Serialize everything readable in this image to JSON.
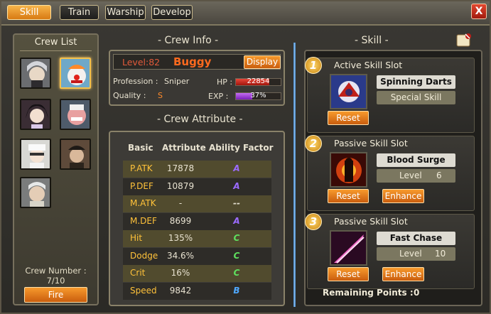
{
  "tabs": [
    {
      "label": "Skill",
      "active": true
    },
    {
      "label": "Train",
      "active": false
    },
    {
      "label": "Warship",
      "active": false
    },
    {
      "label": "Develop",
      "active": false
    }
  ],
  "close_label": "X",
  "crew_list": {
    "title": "Crew List",
    "crew_number_label": "Crew Number :",
    "crew_number": "7/10",
    "fire_label": "Fire"
  },
  "crew_info": {
    "title": "- Crew Info -",
    "level": "Level:82",
    "name": "Buggy",
    "display_label": "Display",
    "profession_label": "Profession :",
    "profession": "Sniper",
    "quality_label": "Quality :",
    "quality": "S",
    "hp_label": "HP :",
    "hp": "22854",
    "exp_label": "EXP :",
    "exp": "37%",
    "exp_fraction": 0.37,
    "hp_fraction": 0.75
  },
  "crew_attribute": {
    "title": "- Crew Attribute -",
    "headers": [
      "Basic",
      "Attribute",
      "Ability Factor"
    ],
    "rows": [
      {
        "basic": "P.ATK",
        "attribute": "17878",
        "factor": "A"
      },
      {
        "basic": "P.DEF",
        "attribute": "10879",
        "factor": "A"
      },
      {
        "basic": "M.ATK",
        "attribute": "-",
        "factor": "--"
      },
      {
        "basic": "M.DEF",
        "attribute": "8699",
        "factor": "A"
      },
      {
        "basic": "Hit",
        "attribute": "135%",
        "factor": "C"
      },
      {
        "basic": "Dodge",
        "attribute": "34.6%",
        "factor": "C"
      },
      {
        "basic": "Crit",
        "attribute": "16%",
        "factor": "C"
      },
      {
        "basic": "Speed",
        "attribute": "9842",
        "factor": "B"
      }
    ],
    "factor_colors": {
      "A": "#9b6bff",
      "B": "#4fa8ff",
      "C": "#5fe05f",
      "--": "#e0dccc"
    }
  },
  "skill": {
    "title": "- Skill -",
    "slots": [
      {
        "number": "1",
        "title": "Active Skill Slot",
        "skill_name": "Spinning Darts",
        "sub": "Special Skill",
        "level_label": "",
        "level": "",
        "reset": "Reset",
        "enhance": ""
      },
      {
        "number": "2",
        "title": "Passive Skill Slot",
        "skill_name": "Blood Surge",
        "sub": "",
        "level_label": "Level",
        "level": "6",
        "reset": "Reset",
        "enhance": "Enhance"
      },
      {
        "number": "3",
        "title": "Passive Skill Slot",
        "skill_name": "Fast Chase",
        "sub": "",
        "level_label": "Level",
        "level": "10",
        "reset": "Reset",
        "enhance": "Enhance"
      }
    ],
    "remaining_label": "Remaining Points :",
    "remaining": "0"
  },
  "colors": {
    "accent_orange": "#e8841f",
    "name_orange": "#ff6a1e",
    "level_red": "#e05a3a",
    "hp_bar": "#d12a1a",
    "exp_bar": "#a23ce0"
  }
}
